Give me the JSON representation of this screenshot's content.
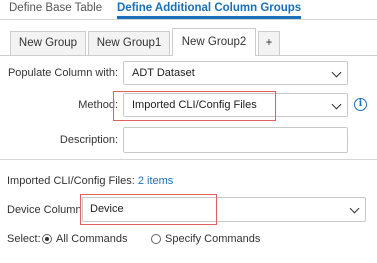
{
  "top_tabs": [
    {
      "label": "Define Base Table",
      "active": false
    },
    {
      "label": "Define Additional Column Groups",
      "active": true
    }
  ],
  "group_tabs": [
    {
      "label": "New Group",
      "active": false
    },
    {
      "label": "New Group1",
      "active": false
    },
    {
      "label": "New Group2",
      "active": true
    },
    {
      "label": "+",
      "active": false
    }
  ],
  "form": {
    "populate_label": "Populate Column with:",
    "populate_value": "ADT Dataset",
    "method_label": "Method:",
    "method_value": "Imported CLI/Config Files",
    "description_label": "Description:",
    "description_value": ""
  },
  "imported": {
    "label": "Imported CLI/Config Files:",
    "count_link": "2 items"
  },
  "device_column": {
    "label": "Device Column:",
    "value": "Device"
  },
  "select": {
    "label": "Select:",
    "options": [
      {
        "label": "All Commands",
        "checked": true
      },
      {
        "label": "Specify Commands",
        "checked": false
      }
    ]
  },
  "colors": {
    "accent": "#1a6fba",
    "highlight_border": "#e06060",
    "text": "#333333"
  },
  "icons": {
    "info": "info-circle-icon",
    "dropdown": "chevron-down-icon"
  }
}
